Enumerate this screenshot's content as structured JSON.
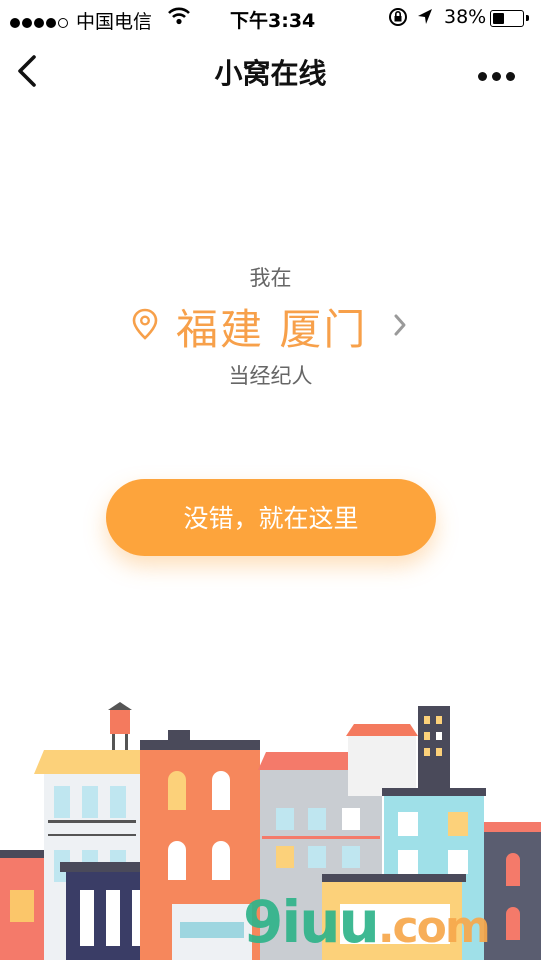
{
  "status_bar": {
    "carrier": "中国电信",
    "time": "下午3:34",
    "battery": "38%",
    "battery_level": 0.38,
    "signal_bars": 4
  },
  "nav": {
    "title": "小窝在线",
    "back_icon": "chevron-left-icon",
    "more_icon": "more-dots-icon"
  },
  "location": {
    "prefix": "我在",
    "city": "福建 厦门",
    "role": "当经纪人",
    "pin_icon": "location-pin-icon",
    "chevron_icon": "chevron-right-icon"
  },
  "confirm_button": {
    "label": "没错，就在这里"
  },
  "watermark": {
    "main": "9iuu",
    "suffix": ".com"
  },
  "colors": {
    "accent": "#fda43c",
    "city_text": "#f7a04a",
    "watermark": "#2fb48a"
  }
}
